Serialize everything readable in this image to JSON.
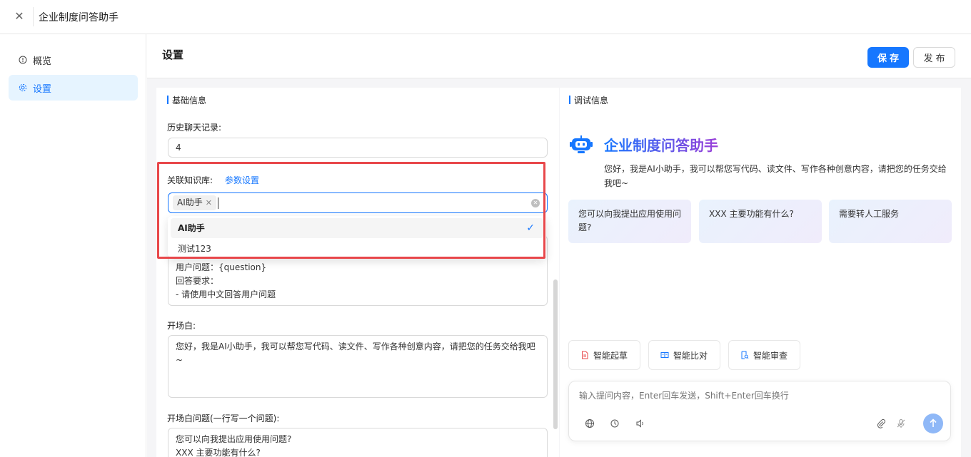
{
  "window": {
    "title": "企业制度问答助手",
    "close_icon": "close-icon"
  },
  "sidebar": {
    "items": [
      {
        "label": "概览",
        "icon": "info-circle-icon",
        "active": false
      },
      {
        "label": "设置",
        "icon": "gear-icon",
        "active": true
      }
    ]
  },
  "header": {
    "page_title": "设置",
    "save_label": "保存",
    "publish_label": "发布"
  },
  "basic": {
    "section_title": "基础信息",
    "history_label": "历史聊天记录:",
    "history_value": "4",
    "kb_label": "关联知识库:",
    "kb_params_link": "参数设置",
    "kb_selected_tag": "AI助手",
    "dropdown_options": [
      {
        "label": "AI助手",
        "selected": true
      },
      {
        "label": "测试123",
        "selected": false
      }
    ],
    "prompt_lines": [
      "用户问题：{question}",
      "回答要求：",
      "- 请使用中文回答用户问题"
    ],
    "opening_label": "开场白:",
    "opening_text": "您好，我是AI小助手，我可以帮您写代码、读文件、写作各种创意内容，请把您的任务交给我吧~",
    "opening_q_label": "开场白问题(一行写一个问题):",
    "opening_q_lines": [
      "您可以向我提出应用使用问题?",
      "XXX 主要功能有什么?"
    ]
  },
  "debug": {
    "section_title": "调试信息",
    "app_name": "企业制度问答助手",
    "greeting": "您好，我是AI小助手，我可以帮您写代码、读文件、写作各种创意内容，请把您的任务交给我吧~",
    "question_cards": [
      "您可以向我提出应用使用问题?",
      "XXX 主要功能有什么?",
      "需要转人工服务"
    ],
    "tools": [
      {
        "label": "智能起草",
        "icon": "document-red-icon",
        "color": "#e8474a"
      },
      {
        "label": "智能比对",
        "icon": "compare-icon",
        "color": "#1677ff"
      },
      {
        "label": "智能审查",
        "icon": "review-icon",
        "color": "#1677ff"
      }
    ],
    "chat_placeholder": "输入提问内容，Enter回车发送，Shift+Enter回车换行"
  },
  "colors": {
    "primary": "#1677ff",
    "highlight": "#e8474a"
  }
}
